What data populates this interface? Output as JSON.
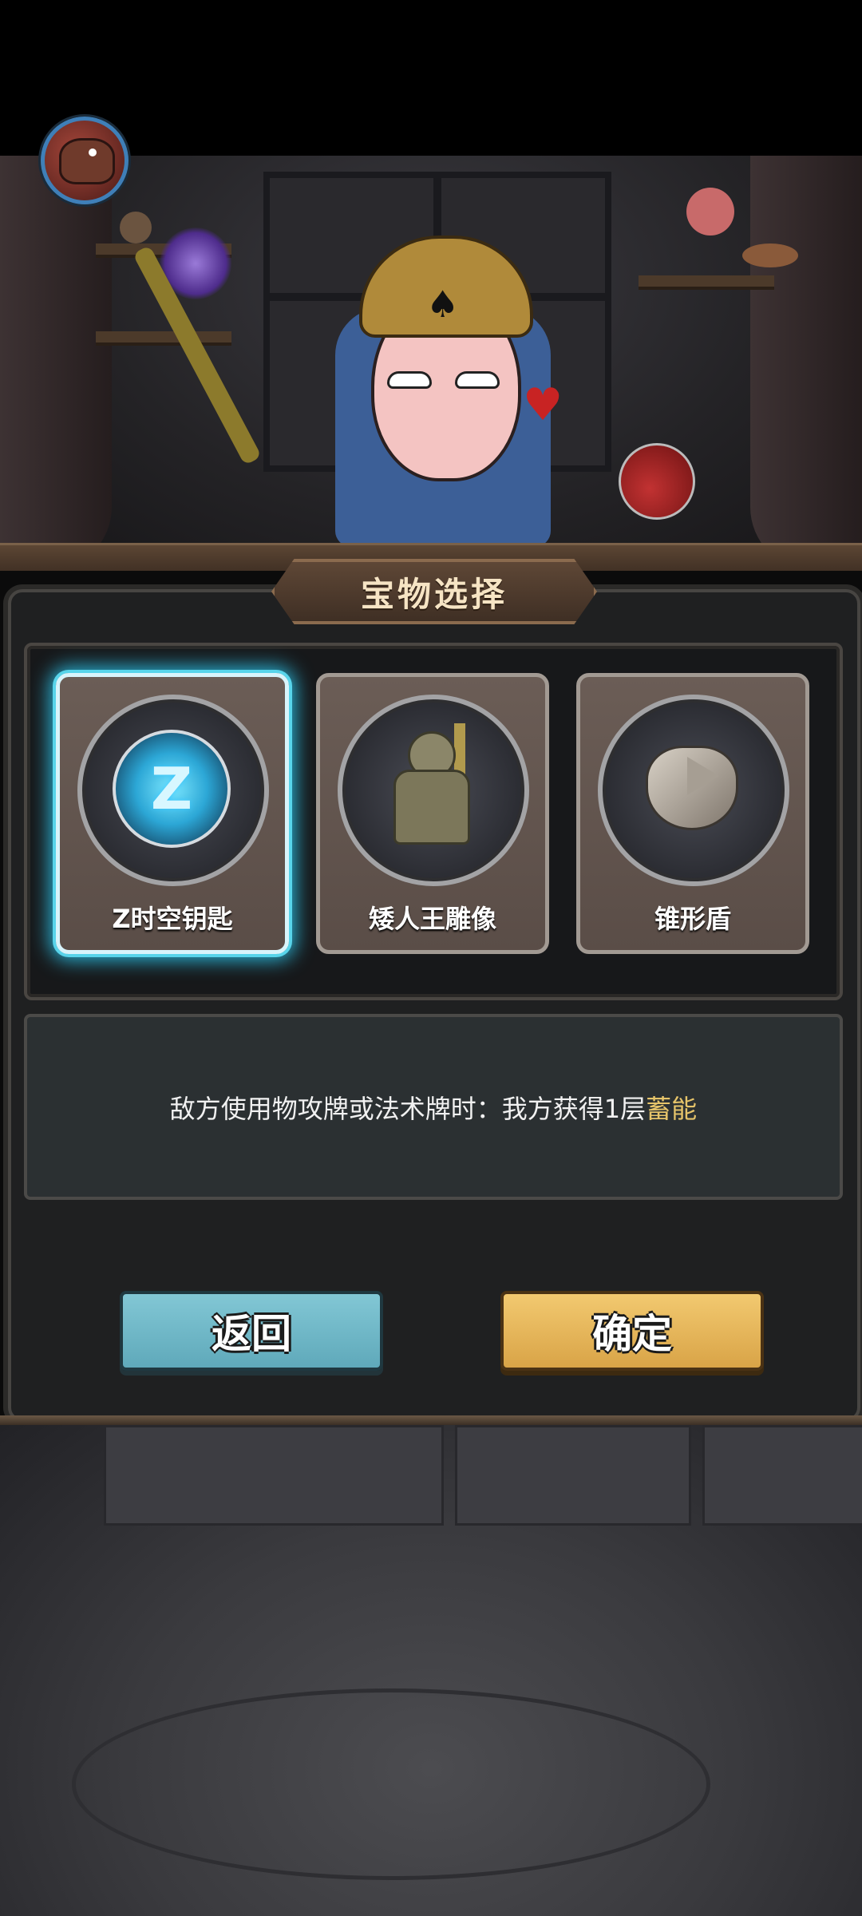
{
  "panel": {
    "title": "宝物选择",
    "treasures": [
      {
        "name": "Z时空钥匙",
        "icon": "time-key-icon",
        "selected": true
      },
      {
        "name": "矮人王雕像",
        "icon": "dwarf-king-statue-icon",
        "selected": false
      },
      {
        "name": "锥形盾",
        "icon": "cone-shield-icon",
        "selected": false
      }
    ],
    "description": {
      "text": "敌方使用物攻牌或法术牌时：我方获得1层",
      "highlight": "蓄能"
    },
    "buttons": {
      "back": "返回",
      "confirm": "确定"
    }
  },
  "colors": {
    "selected_glow": "#2ab2d4",
    "back_button": "#6fb8c8",
    "confirm_button": "#e6b45b",
    "highlight_text": "#e6c46a"
  }
}
